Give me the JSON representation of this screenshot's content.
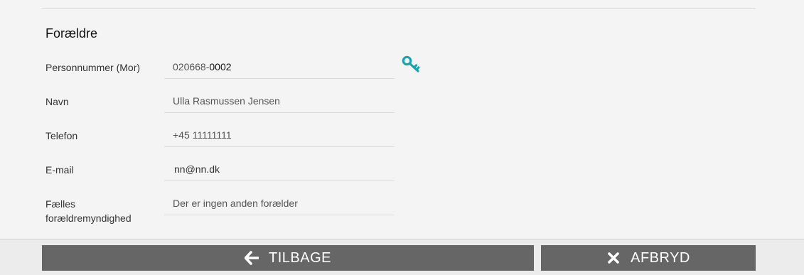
{
  "section": {
    "title": "Forældre"
  },
  "fields": {
    "cpr": {
      "label": "Personnummer (Mor)",
      "value_prefix": "020668-",
      "value_suffix": "0002"
    },
    "name": {
      "label": "Navn",
      "value": "Ulla Rasmussen Jensen"
    },
    "phone": {
      "label": "Telefon",
      "value": "+45 11111111"
    },
    "email": {
      "label": "E-mail",
      "value": "nn@nn.dk"
    },
    "custody": {
      "label_line1": "Fælles",
      "label_line2": "forældremyndighed",
      "value": "Der er ingen anden forælder"
    }
  },
  "icons": {
    "lookup": "key-icon",
    "back": "arrow-left-icon",
    "cancel": "close-icon"
  },
  "colors": {
    "accent": "#1aa3b0",
    "button_bg": "#666666",
    "button_text": "#ffffff"
  },
  "buttons": {
    "back_label": "TILBAGE",
    "cancel_label": "AFBRYD"
  }
}
